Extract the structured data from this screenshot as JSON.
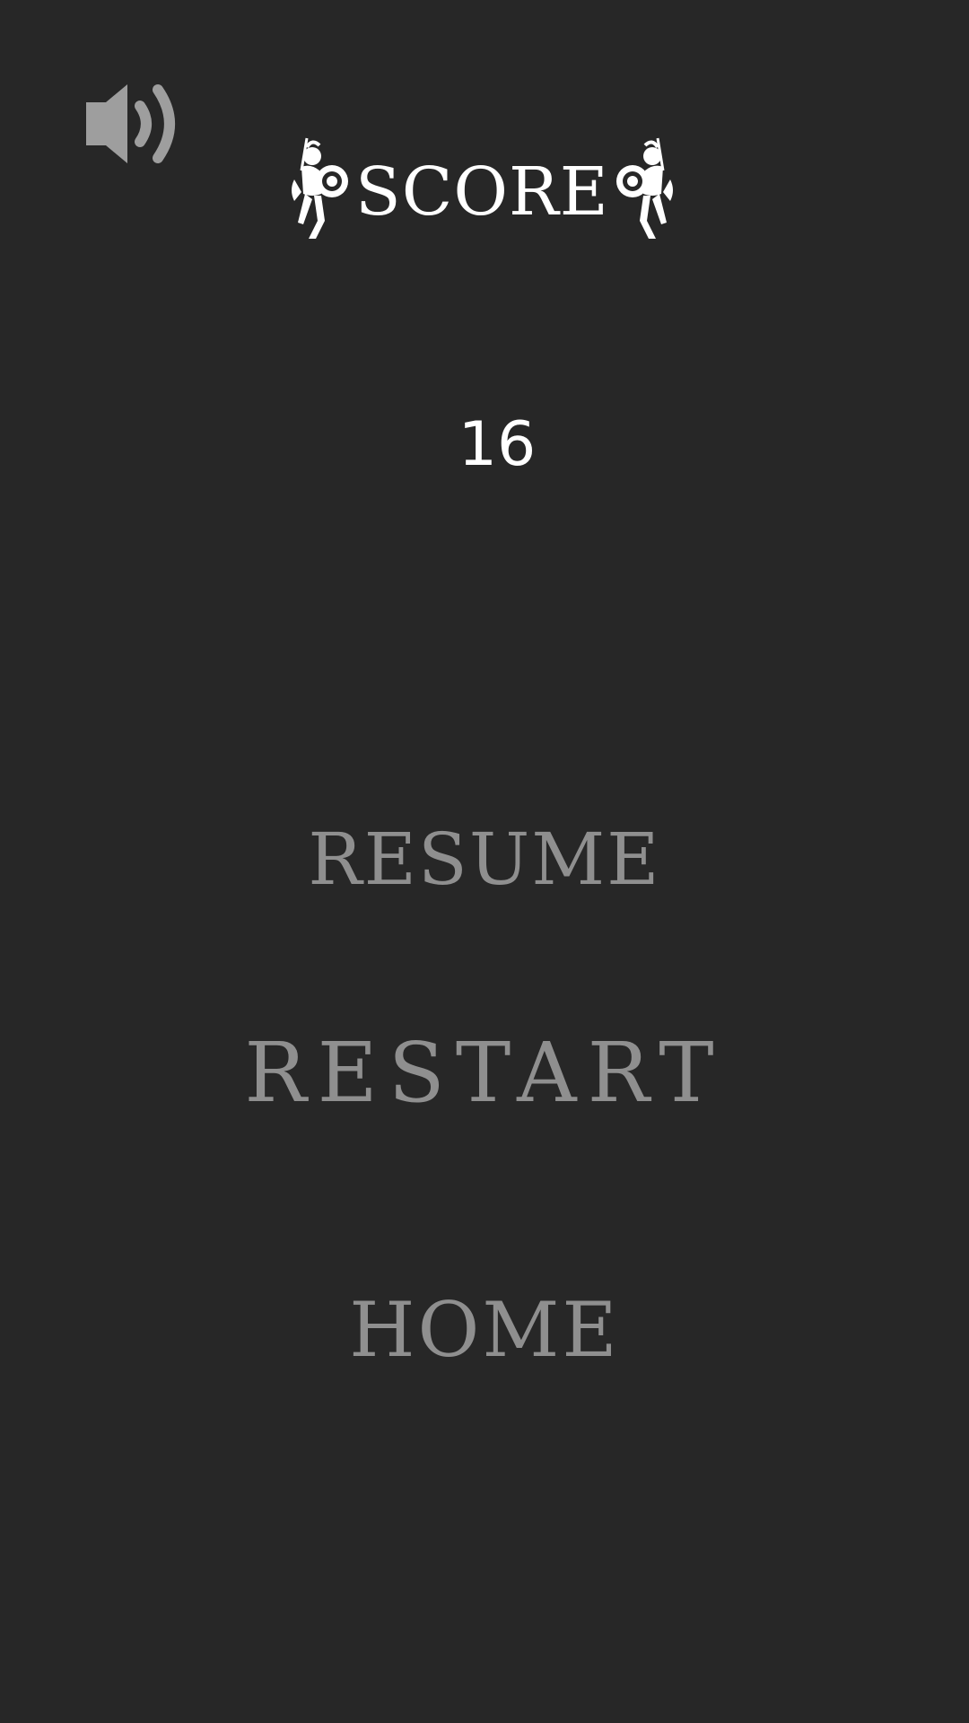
{
  "colors": {
    "background": "#272727",
    "title": "#ffffff",
    "menu_text": "#8f8f8f",
    "sound_icon": "#9e9e9e"
  },
  "header": {
    "sound_icon": "speaker-volume-icon",
    "title": "SCORE",
    "decoration_icon": "spartan-warrior-icon"
  },
  "score": {
    "value": "16"
  },
  "menu": {
    "resume_label": "RESUME",
    "restart_label": "RESTART",
    "home_label": "HOME"
  }
}
